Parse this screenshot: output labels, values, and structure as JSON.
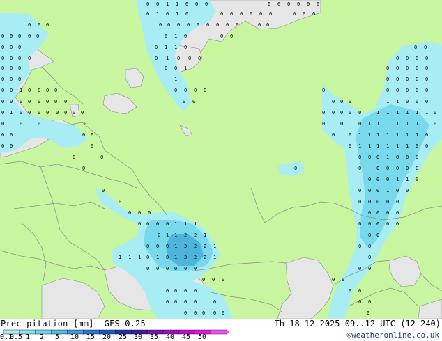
{
  "colors": {
    "land": "#c8f5a0",
    "sea": "#e6e6e6",
    "border": "#8c8c8c",
    "precip_light": "#a8ecf4",
    "precip_mid": "#78d8ec",
    "precip_heavy": "#4fb4dc"
  },
  "legend": {
    "title": "Precipitation [mm]",
    "model": "GFS 0.25",
    "ticks": [
      "0.1",
      "0.5",
      "1",
      "2",
      "5",
      "10",
      "15",
      "20",
      "25",
      "30",
      "35",
      "40",
      "45",
      "50"
    ],
    "colors": [
      "#a8ecf4",
      "#8ce0f0",
      "#70d4ec",
      "#50bce4",
      "#3c9cdc",
      "#2878d0",
      "#1e58c8",
      "#1e32b4",
      "#3c1ea0",
      "#7814b4",
      "#a00ac8",
      "#c80adc",
      "#e614e6",
      "#f050f0"
    ]
  },
  "run_info": "Th 18-12-2025 09..12 UTC (12+240)",
  "credit": "©weatheronline.co.uk",
  "map_labels": [
    [
      "0",
      210,
      8
    ],
    [
      "0",
      224,
      8
    ],
    [
      "1",
      238,
      8
    ],
    [
      "1",
      252,
      8
    ],
    [
      "0",
      266,
      8
    ],
    [
      "0",
      280,
      8
    ],
    [
      "0",
      294,
      8
    ],
    [
      "0",
      384,
      8
    ],
    [
      "0",
      398,
      8
    ],
    [
      "0",
      412,
      8
    ],
    [
      "0",
      426,
      8
    ],
    [
      "0",
      440,
      8
    ],
    [
      "0",
      454,
      8
    ],
    [
      "0",
      210,
      22
    ],
    [
      "1",
      224,
      22
    ],
    [
      "0",
      238,
      22
    ],
    [
      "1",
      252,
      22
    ],
    [
      "0",
      266,
      22
    ],
    [
      "0",
      316,
      22
    ],
    [
      "0",
      330,
      22
    ],
    [
      "0",
      344,
      22
    ],
    [
      "0",
      358,
      22
    ],
    [
      "0",
      372,
      22
    ],
    [
      "0",
      386,
      22
    ],
    [
      "0",
      420,
      22
    ],
    [
      "0",
      434,
      22
    ],
    [
      "0",
      448,
      22
    ],
    [
      "0",
      40,
      38
    ],
    [
      "0",
      54,
      38
    ],
    [
      "0",
      66,
      38
    ],
    [
      "0",
      228,
      38
    ],
    [
      "0",
      240,
      38
    ],
    [
      "0",
      254,
      38
    ],
    [
      "0",
      268,
      38
    ],
    [
      "0",
      282,
      38
    ],
    [
      "0",
      296,
      38
    ],
    [
      "0",
      310,
      38
    ],
    [
      "0",
      324,
      38
    ],
    [
      "0",
      338,
      38
    ],
    [
      "0",
      370,
      38
    ],
    [
      "0",
      382,
      38
    ],
    [
      "0",
      2,
      54
    ],
    [
      "0",
      14,
      54
    ],
    [
      "0",
      26,
      54
    ],
    [
      "0",
      40,
      54
    ],
    [
      "0",
      52,
      54
    ],
    [
      "0",
      236,
      54
    ],
    [
      "1",
      250,
      54
    ],
    [
      "0",
      264,
      54
    ],
    [
      "0",
      316,
      54
    ],
    [
      "0",
      330,
      54
    ],
    [
      "0",
      2,
      70
    ],
    [
      "0",
      14,
      70
    ],
    [
      "0",
      26,
      70
    ],
    [
      "0",
      222,
      70
    ],
    [
      "1",
      236,
      70
    ],
    [
      "1",
      250,
      70
    ],
    [
      "0",
      264,
      70
    ],
    [
      "0",
      594,
      70
    ],
    [
      "0",
      608,
      70
    ],
    [
      "0",
      2,
      86
    ],
    [
      "0",
      14,
      86
    ],
    [
      "0",
      26,
      86
    ],
    [
      "0",
      40,
      86
    ],
    [
      "0",
      222,
      86
    ],
    [
      "1",
      238,
      86
    ],
    [
      "0",
      254,
      86
    ],
    [
      "0",
      270,
      86
    ],
    [
      "0",
      284,
      86
    ],
    [
      "0",
      568,
      86
    ],
    [
      "0",
      582,
      86
    ],
    [
      "0",
      596,
      86
    ],
    [
      "0",
      610,
      86
    ],
    [
      "0",
      2,
      100
    ],
    [
      "0",
      14,
      100
    ],
    [
      "0",
      26,
      100
    ],
    [
      "0",
      236,
      100
    ],
    [
      "0",
      250,
      100
    ],
    [
      "1",
      264,
      100
    ],
    [
      "0",
      554,
      100
    ],
    [
      "0",
      568,
      100
    ],
    [
      "0",
      582,
      100
    ],
    [
      "0",
      596,
      100
    ],
    [
      "0",
      610,
      100
    ],
    [
      "0",
      2,
      116
    ],
    [
      "0",
      14,
      116
    ],
    [
      "0",
      26,
      116
    ],
    [
      "1",
      250,
      116
    ],
    [
      "0",
      554,
      116
    ],
    [
      "0",
      568,
      116
    ],
    [
      "0",
      582,
      116
    ],
    [
      "0",
      596,
      116
    ],
    [
      "0",
      610,
      116
    ],
    [
      "0",
      2,
      132
    ],
    [
      "0",
      14,
      132
    ],
    [
      "1",
      28,
      132
    ],
    [
      "0",
      40,
      132
    ],
    [
      "0",
      54,
      132
    ],
    [
      "0",
      66,
      132
    ],
    [
      "0",
      78,
      132
    ],
    [
      "0",
      250,
      132
    ],
    [
      "0",
      264,
      132
    ],
    [
      "0",
      278,
      132
    ],
    [
      "0",
      292,
      132
    ],
    [
      "0",
      462,
      132
    ],
    [
      "0",
      554,
      132
    ],
    [
      "0",
      568,
      132
    ],
    [
      "0",
      582,
      132
    ],
    [
      "0",
      596,
      132
    ],
    [
      "0",
      610,
      132
    ],
    [
      "0",
      2,
      148
    ],
    [
      "0",
      14,
      148
    ],
    [
      "0",
      28,
      148
    ],
    [
      "0",
      40,
      148
    ],
    [
      "0",
      54,
      148
    ],
    [
      "0",
      66,
      148
    ],
    [
      "0",
      78,
      148
    ],
    [
      "0",
      92,
      148
    ],
    [
      "0",
      262,
      148
    ],
    [
      "0",
      276,
      148
    ],
    [
      "0",
      476,
      148
    ],
    [
      "0",
      488,
      148
    ],
    [
      "0",
      500,
      148
    ],
    [
      "1",
      554,
      148
    ],
    [
      "1",
      568,
      148
    ],
    [
      "0",
      582,
      148
    ],
    [
      "0",
      596,
      148
    ],
    [
      "0",
      610,
      148
    ],
    [
      "0",
      2,
      164
    ],
    [
      "1",
      14,
      164
    ],
    [
      "0",
      28,
      164
    ],
    [
      "0",
      40,
      164
    ],
    [
      "0",
      54,
      164
    ],
    [
      "0",
      66,
      164
    ],
    [
      "0",
      80,
      164
    ],
    [
      "0",
      92,
      164
    ],
    [
      "0",
      104,
      164
    ],
    [
      "0",
      116,
      164
    ],
    [
      "0",
      462,
      164
    ],
    [
      "0",
      476,
      164
    ],
    [
      "0",
      488,
      164
    ],
    [
      "0",
      500,
      164
    ],
    [
      "0",
      514,
      164
    ],
    [
      "1",
      540,
      164
    ],
    [
      "1",
      554,
      164
    ],
    [
      "1",
      568,
      164
    ],
    [
      "1",
      582,
      164
    ],
    [
      "1",
      596,
      164
    ],
    [
      "1",
      610,
      164
    ],
    [
      "0",
      622,
      164
    ],
    [
      "0",
      2,
      180
    ],
    [
      "0",
      28,
      180
    ],
    [
      "0",
      54,
      180
    ],
    [
      "0",
      120,
      180
    ],
    [
      "0",
      462,
      180
    ],
    [
      "0",
      488,
      180
    ],
    [
      "0",
      514,
      180
    ],
    [
      "1",
      528,
      180
    ],
    [
      "1",
      540,
      180
    ],
    [
      "1",
      554,
      180
    ],
    [
      "1",
      568,
      180
    ],
    [
      "1",
      582,
      180
    ],
    [
      "1",
      596,
      180
    ],
    [
      "1",
      610,
      180
    ],
    [
      "0",
      622,
      180
    ],
    [
      "0",
      2,
      196
    ],
    [
      "0",
      14,
      196
    ],
    [
      "0",
      118,
      196
    ],
    [
      "0",
      130,
      196
    ],
    [
      "0",
      476,
      196
    ],
    [
      "0",
      500,
      196
    ],
    [
      "1",
      514,
      196
    ],
    [
      "1",
      528,
      196
    ],
    [
      "1",
      540,
      196
    ],
    [
      "1",
      554,
      196
    ],
    [
      "1",
      568,
      196
    ],
    [
      "1",
      582,
      196
    ],
    [
      "1",
      596,
      196
    ],
    [
      "0",
      610,
      196
    ],
    [
      "0",
      2,
      212
    ],
    [
      "0",
      14,
      212
    ],
    [
      "0",
      130,
      212
    ],
    [
      "0",
      500,
      212
    ],
    [
      "1",
      514,
      212
    ],
    [
      "1",
      528,
      212
    ],
    [
      "1",
      540,
      212
    ],
    [
      "1",
      554,
      212
    ],
    [
      "1",
      568,
      212
    ],
    [
      "1",
      582,
      212
    ],
    [
      "0",
      596,
      212
    ],
    [
      "0",
      610,
      212
    ],
    [
      "0",
      104,
      228
    ],
    [
      "0",
      144,
      228
    ],
    [
      "0",
      514,
      228
    ],
    [
      "0",
      528,
      228
    ],
    [
      "0",
      540,
      228
    ],
    [
      "1",
      554,
      228
    ],
    [
      "0",
      568,
      228
    ],
    [
      "0",
      582,
      228
    ],
    [
      "0",
      596,
      228
    ],
    [
      "0",
      118,
      244
    ],
    [
      "0",
      422,
      244
    ],
    [
      "0",
      514,
      244
    ],
    [
      "0",
      540,
      244
    ],
    [
      "0",
      554,
      244
    ],
    [
      "0",
      568,
      244
    ],
    [
      "0",
      582,
      244
    ],
    [
      "0",
      596,
      244
    ],
    [
      "0",
      528,
      260
    ],
    [
      "0",
      540,
      260
    ],
    [
      "0",
      554,
      260
    ],
    [
      "1",
      568,
      260
    ],
    [
      "1",
      582,
      260
    ],
    [
      "0",
      596,
      260
    ],
    [
      "0",
      146,
      276
    ],
    [
      "0",
      514,
      276
    ],
    [
      "0",
      528,
      276
    ],
    [
      "0",
      540,
      276
    ],
    [
      "1",
      554,
      276
    ],
    [
      "0",
      568,
      276
    ],
    [
      "0",
      582,
      276
    ],
    [
      "0",
      170,
      292
    ],
    [
      "0",
      514,
      292
    ],
    [
      "0",
      528,
      292
    ],
    [
      "0",
      540,
      292
    ],
    [
      "0",
      554,
      292
    ],
    [
      "0",
      568,
      292
    ],
    [
      "0",
      184,
      308
    ],
    [
      "0",
      198,
      308
    ],
    [
      "0",
      212,
      308
    ],
    [
      "0",
      528,
      308
    ],
    [
      "0",
      540,
      308
    ],
    [
      "0",
      554,
      308
    ],
    [
      "0",
      568,
      308
    ],
    [
      "0",
      198,
      324
    ],
    [
      "0",
      210,
      324
    ],
    [
      "0",
      224,
      324
    ],
    [
      "0",
      238,
      324
    ],
    [
      "1",
      250,
      324
    ],
    [
      "1",
      264,
      324
    ],
    [
      "1",
      278,
      324
    ],
    [
      "0",
      514,
      324
    ],
    [
      "0",
      528,
      324
    ],
    [
      "0",
      540,
      324
    ],
    [
      "0",
      554,
      324
    ],
    [
      "0",
      568,
      324
    ],
    [
      "0",
      226,
      340
    ],
    [
      "1",
      238,
      340
    ],
    [
      "1",
      250,
      340
    ],
    [
      "2",
      264,
      340
    ],
    [
      "2",
      278,
      340
    ],
    [
      "1",
      292,
      340
    ],
    [
      "0",
      528,
      340
    ],
    [
      "0",
      540,
      340
    ],
    [
      "0",
      210,
      356
    ],
    [
      "0",
      224,
      356
    ],
    [
      "0",
      238,
      356
    ],
    [
      "1",
      250,
      356
    ],
    [
      "3",
      264,
      356
    ],
    [
      "2",
      278,
      356
    ],
    [
      "2",
      292,
      356
    ],
    [
      "1",
      306,
      356
    ],
    [
      "0",
      514,
      356
    ],
    [
      "0",
      528,
      356
    ],
    [
      "1",
      170,
      372
    ],
    [
      "1",
      184,
      372
    ],
    [
      "1",
      198,
      372
    ],
    [
      "0",
      210,
      372
    ],
    [
      "1",
      224,
      372
    ],
    [
      "0",
      238,
      372
    ],
    [
      "1",
      250,
      372
    ],
    [
      "3",
      264,
      372
    ],
    [
      "2",
      278,
      372
    ],
    [
      "2",
      292,
      372
    ],
    [
      "1",
      306,
      372
    ],
    [
      "0",
      528,
      372
    ],
    [
      "0",
      210,
      388
    ],
    [
      "0",
      224,
      388
    ],
    [
      "0",
      238,
      388
    ],
    [
      "0",
      250,
      388
    ],
    [
      "0",
      264,
      388
    ],
    [
      "0",
      278,
      388
    ],
    [
      "0",
      514,
      388
    ],
    [
      "0",
      528,
      388
    ],
    [
      "0",
      290,
      404
    ],
    [
      "0",
      304,
      404
    ],
    [
      "0",
      318,
      404
    ],
    [
      "0",
      476,
      404
    ],
    [
      "0",
      490,
      404
    ],
    [
      "0",
      238,
      420
    ],
    [
      "0",
      250,
      420
    ],
    [
      "0",
      264,
      420
    ],
    [
      "0",
      278,
      420
    ],
    [
      "0",
      500,
      420
    ],
    [
      "0",
      514,
      420
    ],
    [
      "0",
      238,
      436
    ],
    [
      "0",
      250,
      436
    ],
    [
      "0",
      264,
      436
    ],
    [
      "0",
      278,
      436
    ],
    [
      "0",
      306,
      436
    ],
    [
      "0",
      514,
      436
    ],
    [
      "0",
      528,
      436
    ],
    [
      "0",
      264,
      452
    ],
    [
      "0",
      278,
      452
    ],
    [
      "0",
      290,
      452
    ],
    [
      "0",
      306,
      452
    ],
    [
      "0",
      318,
      452
    ],
    [
      "0",
      526,
      452
    ]
  ]
}
